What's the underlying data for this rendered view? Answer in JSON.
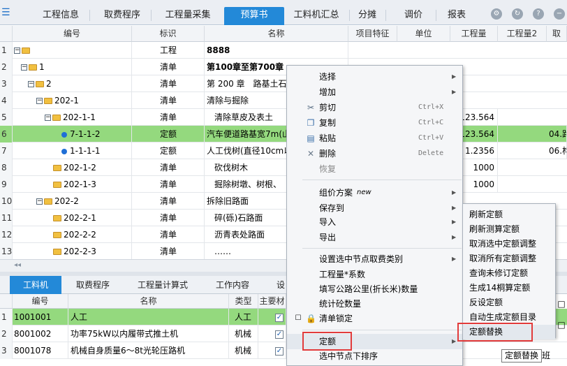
{
  "topbar": {
    "tabs": [
      "工程信息",
      "取费程序",
      "工程量采集",
      "预算书",
      "工料机汇总",
      "分摊",
      "调价",
      "报表"
    ],
    "active_tab": "预算书",
    "icons": [
      "settings-icon",
      "refresh-icon",
      "help-icon",
      "minimize-icon"
    ]
  },
  "grid": {
    "columns": [
      "编号",
      "标识",
      "名称",
      "项目特征",
      "单位",
      "工程量",
      "工程量2",
      "取"
    ],
    "rows": [
      {
        "n": "1",
        "code": "",
        "type": "工程",
        "name": "8888",
        "qty": "",
        "extra": ""
      },
      {
        "n": "2",
        "code": "1",
        "type": "清单",
        "name": "第100章至第700章",
        "qty": "",
        "extra": ""
      },
      {
        "n": "3",
        "code": "2",
        "type": "清单",
        "name": "第 200 章　路基土石",
        "qty": "",
        "extra": ""
      },
      {
        "n": "4",
        "code": "202-1",
        "type": "清单",
        "name": "清除与掘除",
        "qty": "",
        "extra": ""
      },
      {
        "n": "5",
        "code": "202-1-1",
        "type": "清单",
        "name": "清除草皮及表土",
        "qty": "123.564",
        "extra": ""
      },
      {
        "n": "6",
        "code": "7-1-1-2",
        "type": "定额",
        "name": "汽车便道路基宽7m(山",
        "qty": "123.564",
        "extra": "04.路"
      },
      {
        "n": "7",
        "code": "1-1-1-1",
        "type": "定额",
        "name": "人工伐树(直径10cm以",
        "qty": "1.2356",
        "extra": "06.构"
      },
      {
        "n": "8",
        "code": "202-1-2",
        "type": "清单",
        "name": "砍伐树木",
        "qty": "1000",
        "extra": ""
      },
      {
        "n": "9",
        "code": "202-1-3",
        "type": "清单",
        "name": "掘除树墩、树根、",
        "qty": "1000",
        "extra": ""
      },
      {
        "n": "10",
        "code": "202-2",
        "type": "清单",
        "name": "拆除旧路面",
        "qty": "",
        "extra": ""
      },
      {
        "n": "11",
        "code": "202-2-1",
        "type": "清单",
        "name": "碎(砾)石路面",
        "qty": "",
        "extra": ""
      },
      {
        "n": "12",
        "code": "202-2-2",
        "type": "清单",
        "name": "沥青表处路面",
        "qty": "",
        "extra": ""
      },
      {
        "n": "13",
        "code": "202-2-3",
        "type": "清单",
        "name": "……",
        "qty": "",
        "extra": ""
      }
    ]
  },
  "hscroll_label": "◂◂",
  "subtabs": [
    "工料机",
    "取费程序",
    "工程量计算式",
    "工作内容",
    "设"
  ],
  "subgrid": {
    "columns": [
      "编号",
      "名称",
      "类型",
      "主要材"
    ],
    "rows": [
      {
        "n": "1",
        "code": "1001001",
        "name": "人工",
        "type": "人工",
        "check": "✓"
      },
      {
        "n": "2",
        "code": "8001002",
        "name": "功率75kW以内履带式推土机",
        "type": "机械",
        "check": "✓"
      },
      {
        "n": "3",
        "code": "8001078",
        "name": "机械自身质量6～8t光轮压路机",
        "type": "机械",
        "check": "✓"
      }
    ]
  },
  "context_menu": {
    "groups": [
      [
        {
          "label": "选择",
          "arrow": "▶"
        },
        {
          "label": "增加",
          "arrow": "▶"
        },
        {
          "label": "剪切",
          "shortcut": "Ctrl+X",
          "icon": "scissors-icon"
        },
        {
          "label": "复制",
          "shortcut": "Ctrl+C",
          "icon": "copy-icon"
        },
        {
          "label": "粘贴",
          "shortcut": "Ctrl+V",
          "icon": "paste-icon"
        },
        {
          "label": "删除",
          "shortcut": "Delete",
          "icon": "delete-icon"
        },
        {
          "label": "恢复",
          "disabled": true
        }
      ],
      [
        {
          "label": "组价方案",
          "badge": "new",
          "arrow": "▶"
        },
        {
          "label": "保存到",
          "arrow": "▶"
        },
        {
          "label": "导入",
          "arrow": "▶"
        },
        {
          "label": "导出",
          "arrow": "▶"
        }
      ],
      [
        {
          "label": "设置选中节点取费类别",
          "arrow": "▶"
        },
        {
          "label": "工程量*系数"
        },
        {
          "label": "填写公路公里(折长米)数量"
        },
        {
          "label": "统计砼数量"
        },
        {
          "label": "清单锁定",
          "icon": "lock-icon"
        }
      ],
      [
        {
          "label": "定额",
          "arrow": "▶",
          "highlight": true
        },
        {
          "label": "选中节点下排序"
        }
      ]
    ]
  },
  "submenu": {
    "items": [
      "刷新定额",
      "刷新测算定额",
      "取消选中定额调整",
      "取消所有定额调整",
      "查询未修订定额",
      "生成14桐算定额",
      "反设定额",
      "自动生成定额目录",
      "定额替换"
    ],
    "highlight": "定额替换"
  },
  "tooltip": "定额替换",
  "right_edge_text": "班",
  "side_checks": [
    "□",
    "□"
  ],
  "colors": {
    "accent": "#2389d8",
    "selection": "#94d97e",
    "highlight_border": "#e23b3b"
  }
}
